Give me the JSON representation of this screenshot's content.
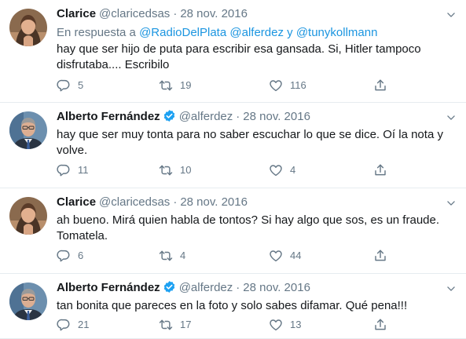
{
  "tweets": [
    {
      "name": "Clarice",
      "handle": "@claricedsas",
      "separator": "·",
      "date": "28 nov. 2016",
      "reply_prefix": "En respuesta a",
      "reply_users": [
        "@RadioDelPlata",
        "@alferdez",
        "@tunykollmann"
      ],
      "reply_sep": "y",
      "lines": [
        "hay que ser hijo de puta para escribir esa gansada. Si, Hitler tampoco",
        "disfrutaba.... Escribilo"
      ],
      "replies": "5",
      "retweets": "19",
      "likes": "116",
      "verified": false
    },
    {
      "name": "Alberto Fernández",
      "handle": "@alferdez",
      "separator": "·",
      "date": "28 nov. 2016",
      "lines": [
        "hay que ser muy tonta para no saber escuchar lo que se dice. Oí la nota y",
        "volve."
      ],
      "replies": "11",
      "retweets": "10",
      "likes": "4",
      "verified": true
    },
    {
      "name": "Clarice",
      "handle": "@claricedsas",
      "separator": "·",
      "date": "28 nov. 2016",
      "lines": [
        "ah bueno. Mirá quien habla de tontos? Si hay algo que sos, es un fraude.",
        "Tomatela."
      ],
      "replies": "6",
      "retweets": "4",
      "likes": "44",
      "verified": false
    },
    {
      "name": "Alberto Fernández",
      "handle": "@alferdez",
      "separator": "·",
      "date": "28 nov. 2016",
      "lines": [
        "tan bonita que pareces en la foto y solo sabes difamar. Qué pena!!!"
      ],
      "replies": "21",
      "retweets": "17",
      "likes": "13",
      "verified": true
    }
  ],
  "colors": {
    "text": "#14171a",
    "secondary": "#657786",
    "link": "#1b95e0",
    "verified": "#1da1f2",
    "divider": "#e6ecf0"
  },
  "icons": {
    "reply": "reply-icon",
    "retweet": "retweet-icon",
    "like": "heart-icon",
    "share": "share-icon",
    "caret": "chevron-down-icon",
    "verified": "verified-badge-icon"
  }
}
